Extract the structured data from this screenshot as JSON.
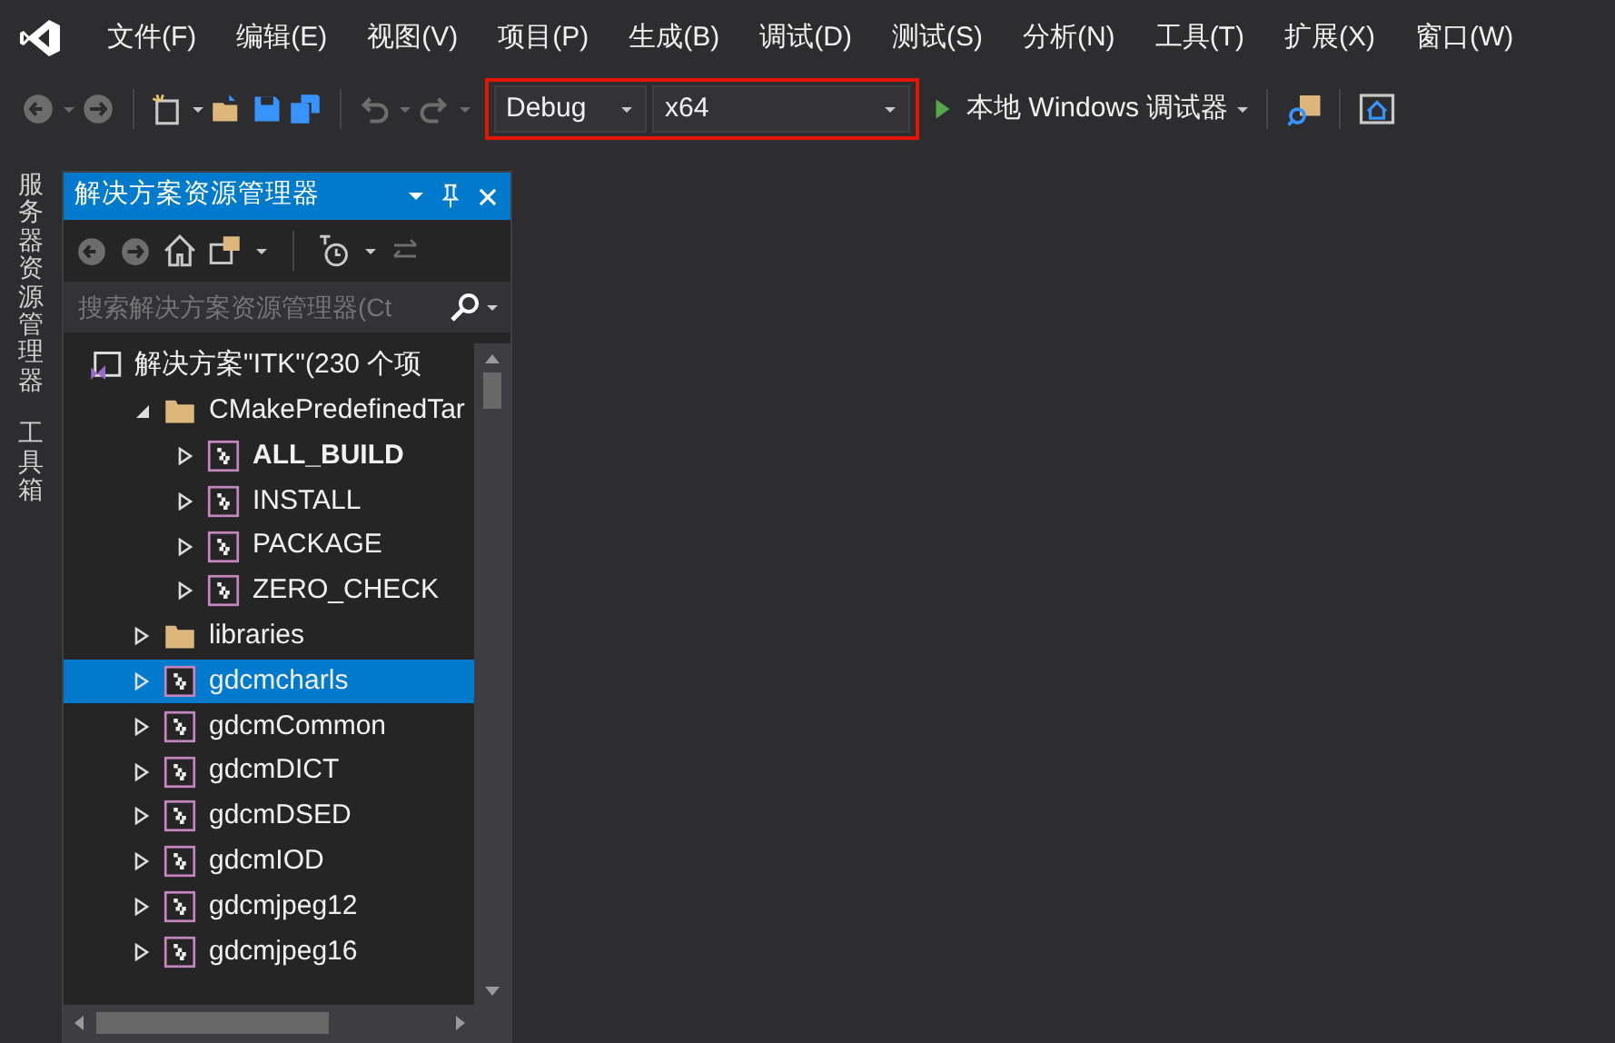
{
  "menu": [
    "文件(F)",
    "编辑(E)",
    "视图(V)",
    "项目(P)",
    "生成(B)",
    "调试(D)",
    "测试(S)",
    "分析(N)",
    "工具(T)",
    "扩展(X)",
    "窗口(W)"
  ],
  "toolbar": {
    "configuration": "Debug",
    "platform": "x64",
    "run_label": "本地 Windows 调试器"
  },
  "side_tabs": [
    "服务器资源管理器",
    "工具箱"
  ],
  "solution_explorer": {
    "title": "解决方案资源管理器",
    "search": {
      "placeholder": "搜索解决方案资源管理器(Ct"
    },
    "tree": [
      {
        "kind": "solution",
        "label": "解决方案\"ITK\"(230 个项",
        "selected": false,
        "children": [
          {
            "kind": "folder",
            "label": "CMakePredefinedTar",
            "expanded": true,
            "selected": false,
            "children": [
              {
                "kind": "project",
                "label": "ALL_BUILD",
                "startup": true,
                "expanded": false,
                "selected": false
              },
              {
                "kind": "project",
                "label": "INSTALL",
                "startup": false,
                "expanded": false,
                "selected": false
              },
              {
                "kind": "project",
                "label": "PACKAGE",
                "startup": false,
                "expanded": false,
                "selected": false
              },
              {
                "kind": "project",
                "label": "ZERO_CHECK",
                "startup": false,
                "expanded": false,
                "selected": false
              }
            ]
          },
          {
            "kind": "folder",
            "label": "libraries",
            "expanded": false,
            "selected": false
          },
          {
            "kind": "project",
            "label": "gdcmcharls",
            "startup": false,
            "expanded": false,
            "selected": true
          },
          {
            "kind": "project",
            "label": "gdcmCommon",
            "startup": false,
            "expanded": false,
            "selected": false
          },
          {
            "kind": "project",
            "label": "gdcmDICT",
            "startup": false,
            "expanded": false,
            "selected": false
          },
          {
            "kind": "project",
            "label": "gdcmDSED",
            "startup": false,
            "expanded": false,
            "selected": false
          },
          {
            "kind": "project",
            "label": "gdcmIOD",
            "startup": false,
            "expanded": false,
            "selected": false
          },
          {
            "kind": "project",
            "label": "gdcmjpeg12",
            "startup": false,
            "expanded": false,
            "selected": false
          },
          {
            "kind": "project",
            "label": "gdcmjpeg16",
            "startup": false,
            "expanded": false,
            "selected": false
          }
        ]
      }
    ]
  }
}
